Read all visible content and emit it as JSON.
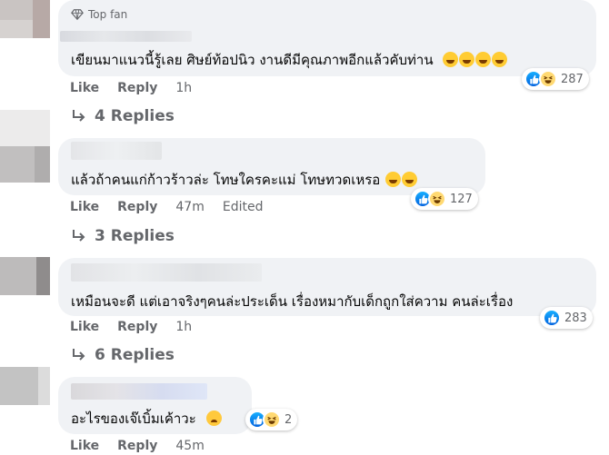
{
  "comments": [
    {
      "badge": "Top fan",
      "text": "เขียนมาแนวนี้รู้เลย ศิษย์ท้อปนิว งานดีมีคุณภาพอีกแล้วคับท่าน",
      "emojis": [
        "haha-emoji",
        "haha-emoji",
        "haha-emoji",
        "haha-emoji"
      ],
      "reaction_count": "287",
      "like_label": "Like",
      "reply_label": "Reply",
      "time": "1h",
      "replies_label": "4 Replies"
    },
    {
      "text": "แล้วถ้าคนแก่ก้าวร้าวล่ะ โทษใครคะแม่ โทษทวดเหรอ",
      "emojis": [
        "haha-emoji",
        "haha-emoji"
      ],
      "reaction_count": "127",
      "like_label": "Like",
      "reply_label": "Reply",
      "time": "47m",
      "edited": "Edited",
      "replies_label": "3 Replies"
    },
    {
      "text": "เหมือนจะดี แต่เอาจริงๆคนล่ะประเด็น เรื่องหมากับเด็กถูกใส่ความ คนล่ะเรื่อง",
      "reaction_count": "283",
      "like_label": "Like",
      "reply_label": "Reply",
      "time": "1h",
      "replies_label": "6 Replies"
    },
    {
      "text": "อะไรของเจ๊เบิ้มเค้าวะ",
      "emojis": [
        "sad-face-emoji"
      ],
      "reaction_count": "2",
      "like_label": "Like",
      "reply_label": "Reply",
      "time": "45m"
    }
  ],
  "colors": {
    "bubble": "#f0f2f5",
    "secondary_text": "#65676b",
    "like_blue": "#0866ff",
    "haha_yellow": "#ffd972"
  }
}
